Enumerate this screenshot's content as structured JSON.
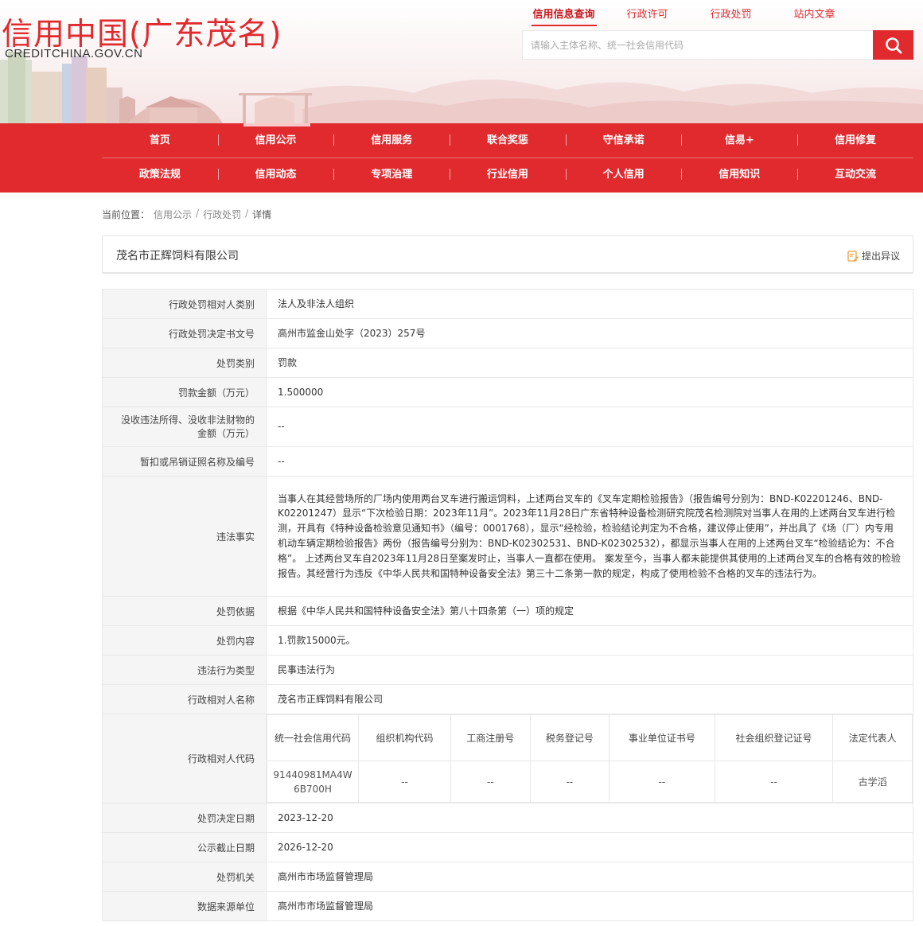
{
  "header": {
    "logo_cn": "信用中国(广东茂名)",
    "logo_en": "CREDITCHINA.GOV.CN",
    "top_links": [
      "信用信息查询",
      "行政许可",
      "行政处罚",
      "站内文章"
    ],
    "search_placeholder": "请输入主体名称、统一社会信用代码"
  },
  "nav": {
    "row1": [
      "首页",
      "信用公示",
      "信用服务",
      "联合奖惩",
      "守信承诺",
      "信易+",
      "信用修复"
    ],
    "row2": [
      "政策法规",
      "信用动态",
      "专项治理",
      "行业信用",
      "个人信用",
      "信用知识",
      "互动交流"
    ]
  },
  "breadcrumb": {
    "prefix": "当前位置：",
    "items": [
      "信用公示",
      "行政处罚",
      "详情"
    ]
  },
  "title": {
    "company": "茂名市正辉饲料有限公司",
    "objection": "提出异议"
  },
  "detail": {
    "rows_top": [
      {
        "label": "行政处罚相对人类别",
        "value": "法人及非法人组织"
      },
      {
        "label": "行政处罚决定书文号",
        "value": "高州市监金山处字（2023）257号"
      },
      {
        "label": "处罚类别",
        "value": "罚款"
      },
      {
        "label": "罚款金额（万元）",
        "value": "1.500000"
      },
      {
        "label": "没收违法所得、没收非法财物的金额（万元）",
        "value": "--"
      },
      {
        "label": "暂扣或吊销证照名称及编号",
        "value": "--"
      },
      {
        "label": "违法事实",
        "value": "当事人在其经营场所的厂场内使用两台叉车进行搬运饲料，上述两台叉车的《叉车定期检验报告》（报告编号分别为：BND-K02201246、BND-K02201247）显示“下次检验日期：2023年11月”。2023年11月28日广东省特种设备检测研究院茂名检测院对当事人在用的上述两台叉车进行检测，开具有《特种设备检验意见通知书》（编号：0001768），显示“经检验，检验结论判定为不合格，建议停止使用”，并出具了《场（厂）内专用机动车辆定期检验报告》两份（报告编号分别为：BND-K02302531、BND-K02302532），都显示当事人在用的上述两台叉车“检验结论为：不合格”。 上述两台叉车自2023年11月28日至案发时止，当事人一直都在使用。 案发至今，当事人都未能提供其使用的上述两台叉车的合格有效的检验报告。其经营行为违反《中华人民共和国特种设备安全法》第三十二条第一款的规定，构成了使用检验不合格的叉车的违法行为。"
      },
      {
        "label": "处罚依据",
        "value": "根据《中华人民共和国特种设备安全法》第八十四条第（一）项的规定"
      },
      {
        "label": "处罚内容",
        "value": "1.罚款15000元。"
      },
      {
        "label": "违法行为类型",
        "value": "民事违法行为"
      },
      {
        "label": "行政相对人名称",
        "value": "茂名市正辉饲料有限公司"
      }
    ],
    "code_label": "行政相对人代码",
    "code_headers": [
      "统一社会信用代码",
      "组织机构代码",
      "工商注册号",
      "税务登记号",
      "事业单位证书号",
      "社会组织登记证号",
      "法定代表人"
    ],
    "code_values": [
      "91440981MA4W6B700H",
      "--",
      "--",
      "--",
      "--",
      "--",
      "古学滔"
    ],
    "rows_bottom": [
      {
        "label": "处罚决定日期",
        "value": "2023-12-20"
      },
      {
        "label": "公示截止日期",
        "value": "2026-12-20"
      },
      {
        "label": "处罚机关",
        "value": "高州市市场监督管理局"
      },
      {
        "label": "数据来源单位",
        "value": "高州市市场监督管理局"
      }
    ]
  },
  "colors": {
    "brand_red": "#e02a2e",
    "label_bg": "#f5f5f5",
    "border": "#e8e8e8"
  }
}
